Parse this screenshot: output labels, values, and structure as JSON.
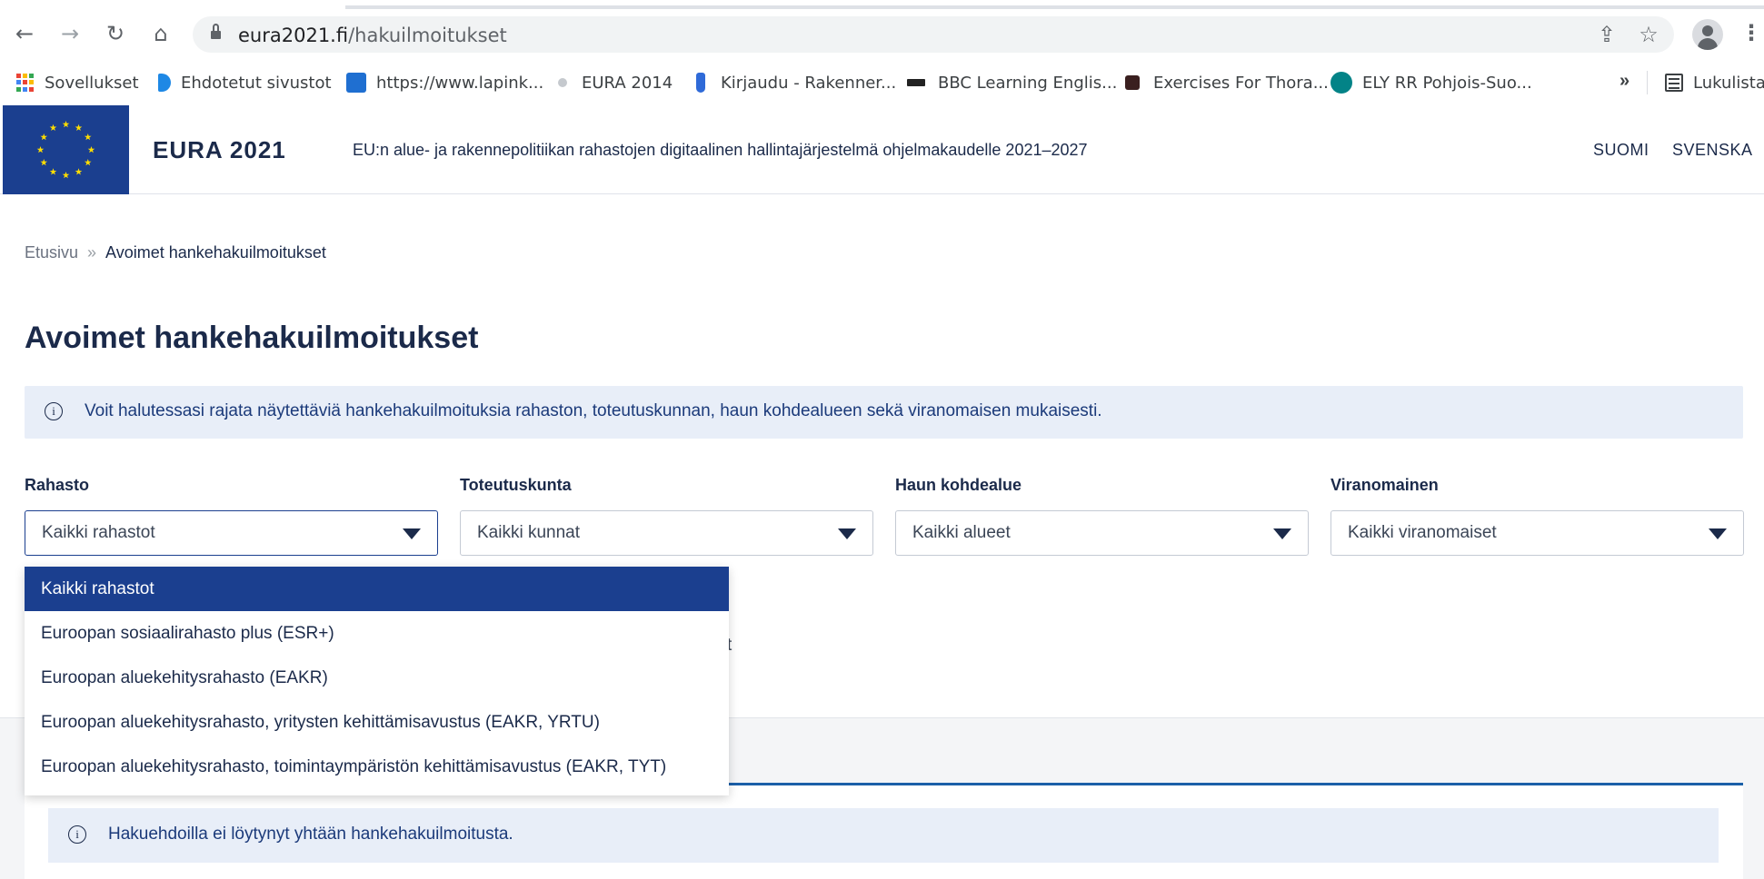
{
  "browser": {
    "url_host": "eura2021.fi",
    "url_path": "/hakuilmoitukset",
    "bookmarks": [
      {
        "label": "Sovellukset",
        "icon": "apps-grid-icon"
      },
      {
        "label": "Ehdotetut sivustot",
        "icon": "bing-icon",
        "color": "#1e88e5"
      },
      {
        "label": "https://www.lapink...",
        "icon": "lapinkansa-icon",
        "color": "#1f6fd1"
      },
      {
        "label": "EURA 2014",
        "icon": "eura-icon",
        "color": "#9aa0a6"
      },
      {
        "label": "Kirjaudu - Rakenner...",
        "icon": "rakennerahasto-icon",
        "color": "#2f6ad8"
      },
      {
        "label": "BBC Learning Englis...",
        "icon": "bbc-icon",
        "color": "#222222"
      },
      {
        "label": "Exercises For Thora...",
        "icon": "p-icon",
        "color": "#3a1f1f"
      },
      {
        "label": "ELY RR Pohjois-Suo...",
        "icon": "sharepoint-icon",
        "color": "#038387"
      }
    ],
    "reading_list": "Lukulista",
    "more_bookmarks": "»"
  },
  "header": {
    "site_name": "EURA 2021",
    "tagline": "EU:n alue- ja rakennepolitiikan rahastojen digitaalinen hallintajärjestelmä ohjelmakaudelle 2021–2027",
    "lang_fi": "SUOMI",
    "lang_sv": "SVENSKA",
    "flag_color": "#1b3f8f",
    "star_color": "#ffdd00"
  },
  "breadcrumb": {
    "home": "Etusivu",
    "separator": "»",
    "current": "Avoimet hankehakuilmoitukset"
  },
  "page": {
    "title": "Avoimet hankehakuilmoitukset",
    "info": "Voit halutessasi rajata näytettäviä hankehakuilmoituksia rahaston, toteutuskunnan, haun kohdealueen sekä viranomaisen mukaisesti.",
    "info_icon": "i"
  },
  "filters": [
    {
      "label": "Rahasto",
      "value": "Kaikki rahastot",
      "open": true
    },
    {
      "label": "Toteutuskunta",
      "value": "Kaikki kunnat"
    },
    {
      "label": "Haun kohdealue",
      "value": "Kaikki alueet"
    },
    {
      "label": "Viranomainen",
      "value": "Kaikki viranomaiset"
    }
  ],
  "dropdown": {
    "selected_index": 0,
    "options": [
      "Kaikki rahastot",
      "Euroopan sosiaalirahasto plus (ESR+)",
      "Euroopan aluekehitysrahasto (EAKR)",
      "Euroopan aluekehitysrahasto, yritysten kehittämisavustus (EAKR, YRTU)",
      "Euroopan aluekehitysrahasto, toimintaympäristön kehittämisavustus (EAKR, TYT)"
    ]
  },
  "obscured_text": "t",
  "results": {
    "empty_message": "Hakuehdoilla ei löytynyt yhtään hankehakuilmoitusta."
  }
}
